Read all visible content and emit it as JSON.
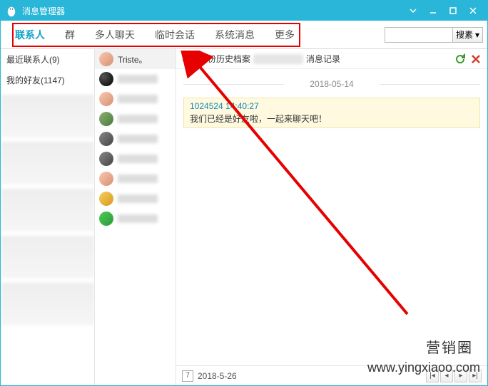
{
  "window": {
    "title": "消息管理器"
  },
  "tabs": [
    "联系人",
    "群",
    "多人聊天",
    "临时会话",
    "系统消息",
    "更多"
  ],
  "active_tab": 0,
  "search": {
    "placeholder": "",
    "button": "搜素"
  },
  "sidebar_groups": {
    "recent": "最近联系人(9)",
    "friends": "我的好友(1147)"
  },
  "contacts": [
    {
      "name": "Triste。",
      "avatar_class": "av-a",
      "selected": true
    },
    {
      "name": "",
      "avatar_class": "av-penguin"
    },
    {
      "name": "",
      "avatar_class": "av-a"
    },
    {
      "name": "",
      "avatar_class": "av-b"
    },
    {
      "name": "",
      "avatar_class": "av-c"
    },
    {
      "name": "",
      "avatar_class": "av-c"
    },
    {
      "name": "",
      "avatar_class": "av-a"
    },
    {
      "name": "",
      "avatar_class": "av-d"
    },
    {
      "name": "",
      "avatar_class": "av-e"
    }
  ],
  "main": {
    "header_prefix": "与第二份历史档案",
    "header_suffix": "消息记录",
    "date_divider": "2018-05-14",
    "message": {
      "meta": "1024524 14:40:27",
      "text": "我们已经是好友啦，一起来聊天吧！"
    }
  },
  "footer": {
    "calendar_num": "7",
    "date": "2018-5-26"
  },
  "watermark": {
    "text": "营销圈",
    "url": "www.yingxiaoo.com"
  }
}
